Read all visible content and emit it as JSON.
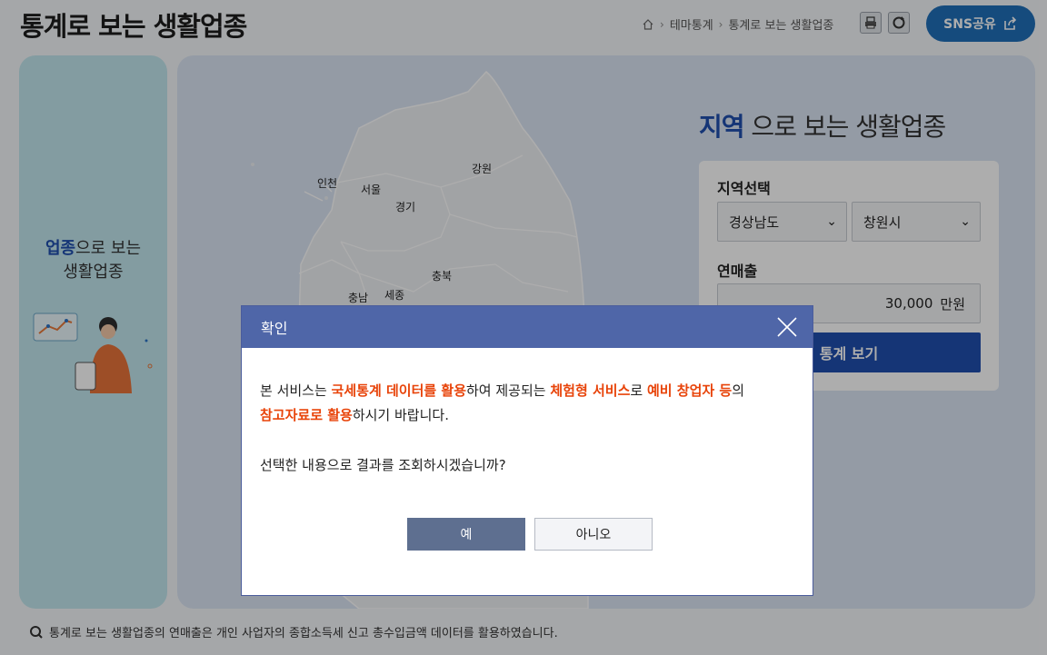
{
  "header": {
    "title": "통계로 보는 생활업종",
    "breadcrumb": [
      "테마통계",
      "통계로 보는 생활업종"
    ],
    "sns_label": "SNS공유"
  },
  "left_panel": {
    "highlight": "업종",
    "line1_rest": "으로 보는",
    "line2": "생활업종"
  },
  "map": {
    "regions": [
      "강원",
      "인천",
      "서울",
      "경기",
      "충북",
      "충남",
      "세종"
    ]
  },
  "right": {
    "title_highlight": "지역",
    "title_rest": " 으로 보는 생활업종",
    "region_label": "지역선택",
    "province": "경상남도",
    "city": "창원시",
    "sales_label": "연매출",
    "sales_value": "30,000",
    "sales_unit": "만원",
    "stats_button": "통계 보기"
  },
  "footnote": "통계로 보는 생활업종의 연매출은 개인 사업자의 종합소득세 신고 총수입금액 데이터를 활용하였습니다.",
  "modal": {
    "title": "확인",
    "p1_a": "본 서비스는 ",
    "p1_hl1": "국세통계 데이터를 활용",
    "p1_b": "하여 제공되는 ",
    "p1_hl2": "체험형 서비스",
    "p1_c": "로 ",
    "p1_hl3": "예비 창업자 등",
    "p1_d": "의",
    "p2_hl": "참고자료로 활용",
    "p2_rest": "하시기 바랍니다.",
    "question": "선택한 내용으로 결과를 조회하시겠습니까?",
    "yes": "예",
    "no": "아니오"
  },
  "colors": {
    "accent": "#1f4fae",
    "highlight": "#e8440a",
    "modal_header": "#4f66a8"
  }
}
